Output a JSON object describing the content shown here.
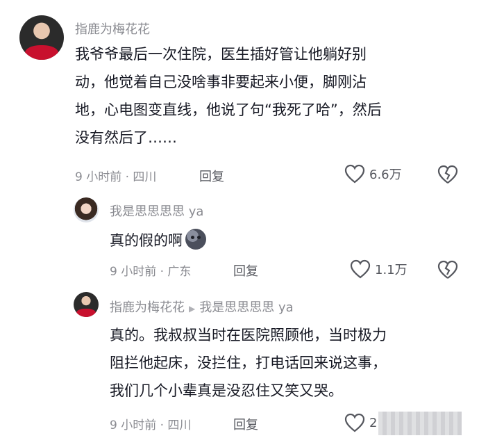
{
  "comments": [
    {
      "author": "指鹿为梅花花",
      "lines": [
        "我爷爷最后一次住院，医生插好管让他躺好别",
        "动，他觉着自己没啥事非要起来小便，脚刚沾",
        "地，心电图变直线，他说了句“我死了哈”，然后",
        "没有然后了……"
      ],
      "time_location": "9 小时前 · 四川",
      "reply_label": "回复",
      "likes": "6.6万"
    },
    {
      "author": "我是思思思思 ya",
      "text": "真的假的啊",
      "emoji": "moon-face-icon",
      "time_location": "9 小时前 · 广东",
      "reply_label": "回复",
      "likes": "1.1万"
    },
    {
      "author": "指鹿为梅花花",
      "reply_to": "我是思思思思 ya",
      "lines": [
        "真的。我叔叔当时在医院照顾他，当时极力",
        "阻拦他起床，没拦住，打电话回来说这事，",
        "我们几个小辈真是没忍住又笑又哭。"
      ],
      "time_location": "9 小时前 · 四川",
      "reply_label": "回复",
      "likes": "2"
    }
  ],
  "colors": {
    "text": "#161823",
    "secondary": "#8a8b91",
    "jersey": "#c8102e"
  }
}
